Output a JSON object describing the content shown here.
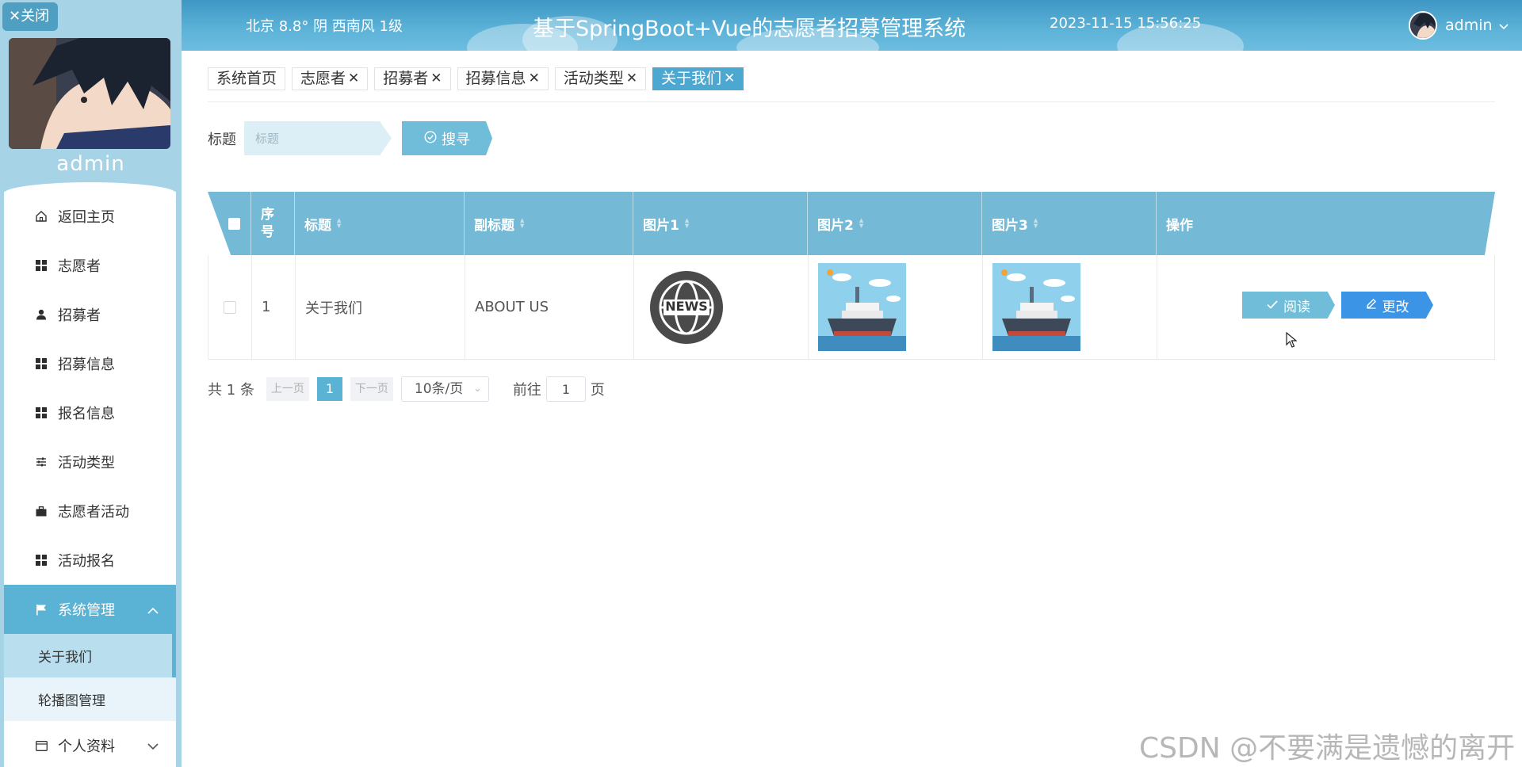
{
  "sidebar": {
    "close_label": "✕关闭",
    "username": "admin",
    "menu": [
      {
        "label": "返回主页",
        "icon": "home-icon"
      },
      {
        "label": "志愿者",
        "icon": "grid-icon"
      },
      {
        "label": "招募者",
        "icon": "user-icon"
      },
      {
        "label": "招募信息",
        "icon": "grid-icon"
      },
      {
        "label": "报名信息",
        "icon": "grid-icon"
      },
      {
        "label": "活动类型",
        "icon": "sliders-icon"
      },
      {
        "label": "志愿者活动",
        "icon": "briefcase-icon"
      },
      {
        "label": "活动报名",
        "icon": "grid-icon"
      }
    ],
    "system": {
      "label": "系统管理",
      "icon": "flag-icon",
      "expanded": true,
      "children": [
        {
          "label": "关于我们",
          "active": true
        },
        {
          "label": "轮播图管理",
          "active": false
        }
      ]
    },
    "profile": {
      "label": "个人资料",
      "icon": "card-icon"
    }
  },
  "header": {
    "weather": "北京  8.8°  阴  西南风  1级",
    "title": "基于SpringBoot+Vue的志愿者招募管理系统",
    "datetime": "2023-11-15 15:56:25",
    "user": "admin"
  },
  "tabs": [
    {
      "label": "系统首页",
      "closable": false,
      "active": false
    },
    {
      "label": "志愿者",
      "closable": true,
      "active": false
    },
    {
      "label": "招募者",
      "closable": true,
      "active": false
    },
    {
      "label": "招募信息",
      "closable": true,
      "active": false
    },
    {
      "label": "活动类型",
      "closable": true,
      "active": false
    },
    {
      "label": "关于我们",
      "closable": true,
      "active": true
    }
  ],
  "search": {
    "label": "标题",
    "placeholder": "标题",
    "button": "搜寻"
  },
  "table": {
    "columns": {
      "index": "序号",
      "title": "标题",
      "subtitle": "副标题",
      "pic1": "图片1",
      "pic2": "图片2",
      "pic3": "图片3",
      "actions": "操作"
    },
    "rows": [
      {
        "index": "1",
        "title": "关于我们",
        "subtitle": "ABOUT US",
        "pic1_text": "NEWS"
      }
    ],
    "actions": {
      "read": "阅读",
      "edit": "更改"
    }
  },
  "pagination": {
    "total": "共 1 条",
    "prev": "上一页",
    "current": "1",
    "next": "下一页",
    "page_size": "10条/页",
    "goto_prefix": "前往",
    "goto_value": "1",
    "goto_suffix": "页"
  },
  "watermark": "CSDN @不要满是遗憾的离开",
  "colors": {
    "accent": "#5ab3d4",
    "header": "#4ca7d1",
    "edit_button": "#3b94e6",
    "sidebar_bg": "#a7d3e6"
  }
}
